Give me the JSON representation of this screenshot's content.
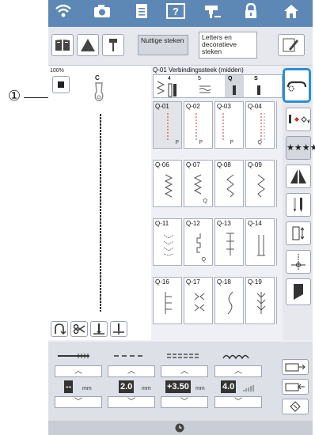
{
  "callout": {
    "number": "①"
  },
  "top_icons": [
    "wifi-icon",
    "camera-icon",
    "document-icon",
    "help-icon",
    "sewing-icon",
    "lock-icon",
    "home-icon"
  ],
  "toolbar": {
    "tab1": "Nuttige steken",
    "tab2": "Letters en decoratieve steken"
  },
  "left": {
    "zoom": "100%",
    "presser_foot_letter": "C"
  },
  "category": {
    "title": "Q-01 Verbindingssteek (midden)",
    "preview_labels": [
      "4",
      "5",
      "Q",
      "S"
    ]
  },
  "stitches": [
    {
      "code": "Q-01",
      "foot": "P"
    },
    {
      "code": "Q-02",
      "foot": "P"
    },
    {
      "code": "Q-03",
      "foot": "P"
    },
    {
      "code": "Q-04",
      "foot": "Q"
    },
    {
      "code": "Q-06",
      "foot": ""
    },
    {
      "code": "Q-07",
      "foot": "Q"
    },
    {
      "code": "Q-08",
      "foot": ""
    },
    {
      "code": "Q-09",
      "foot": ""
    },
    {
      "code": "Q-11",
      "foot": ""
    },
    {
      "code": "Q-12",
      "foot": "Q"
    },
    {
      "code": "Q-13",
      "foot": ""
    },
    {
      "code": "Q-14",
      "foot": ""
    },
    {
      "code": "Q-16",
      "foot": ""
    },
    {
      "code": "Q-17",
      "foot": ""
    },
    {
      "code": "Q-18",
      "foot": ""
    },
    {
      "code": "Q-19",
      "foot": ""
    }
  ],
  "settings": {
    "width_value": "--",
    "width_unit": "mm",
    "length_value": "2.0",
    "length_unit": "mm",
    "position_value": "+3.50",
    "position_unit": "mm",
    "tension_value": "4.0"
  }
}
